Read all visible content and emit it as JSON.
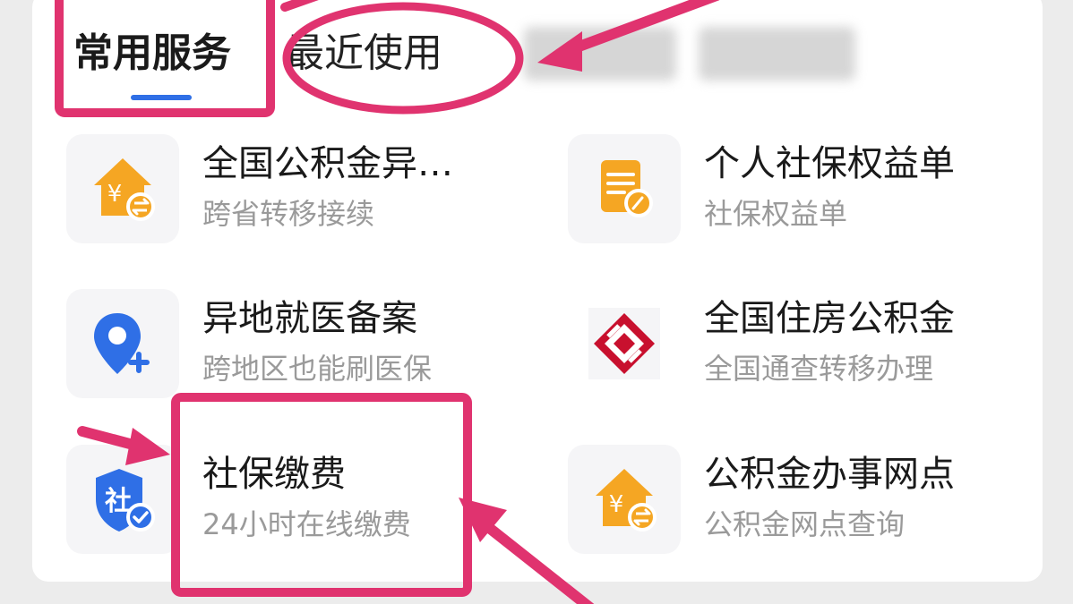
{
  "tabs": {
    "active_label": "常用服务",
    "recent_label": "最近使用"
  },
  "colors": {
    "accent": "#2f6fe6",
    "annotation": "#e0336f",
    "orange": "#f5a623",
    "blue": "#2f6fe6",
    "red": "#c8102e"
  },
  "services": [
    {
      "title": "全国公积金异…",
      "subtitle": "跨省转移接续",
      "icon": "house-yen-transfer-icon"
    },
    {
      "title": "个人社保权益单",
      "subtitle": "社保权益单",
      "icon": "document-pen-icon"
    },
    {
      "title": "异地就医备案",
      "subtitle": "跨地区也能刷医保",
      "icon": "location-plus-icon"
    },
    {
      "title": "全国住房公积金",
      "subtitle": "全国通查转移办理",
      "icon": "housing-fund-logo"
    },
    {
      "title": "社保缴费",
      "subtitle": "24小时在线缴费",
      "icon": "social-security-shield-icon"
    },
    {
      "title": "公积金办事网点",
      "subtitle": "公积金网点查询",
      "icon": "house-yen-transfer-icon"
    }
  ]
}
